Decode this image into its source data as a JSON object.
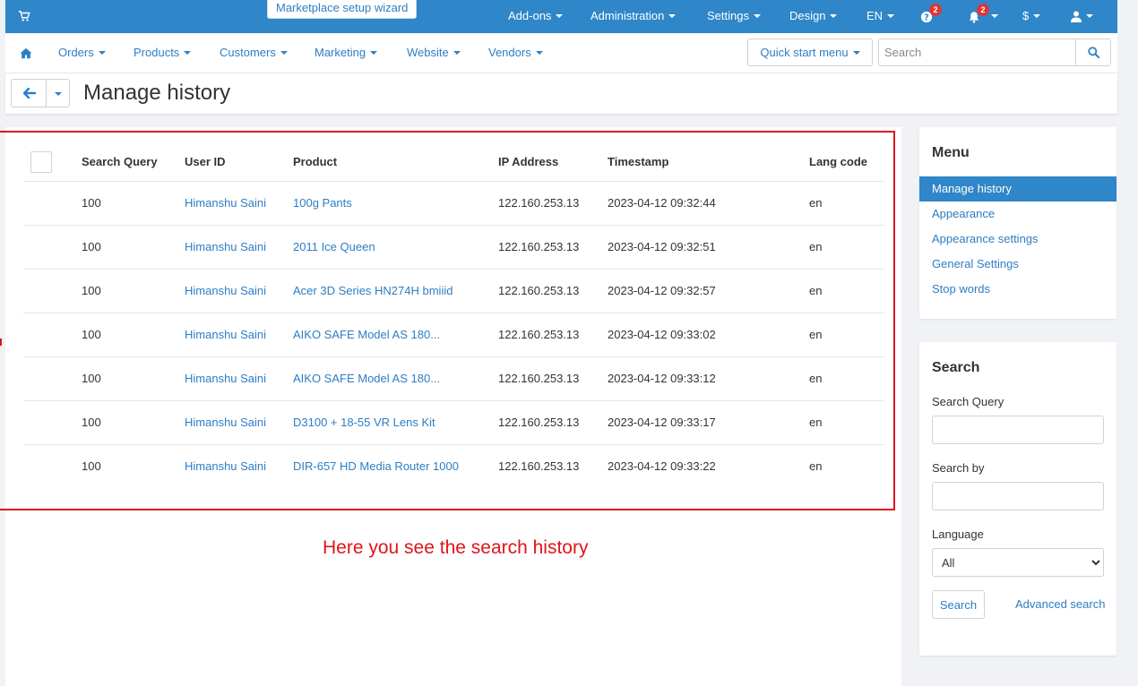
{
  "topbar": {
    "wizard_label": "Marketplace setup wizard",
    "nav": [
      {
        "label": "Add-ons"
      },
      {
        "label": "Administration"
      },
      {
        "label": "Settings"
      },
      {
        "label": "Design"
      },
      {
        "label": "EN"
      },
      {
        "label": "$"
      }
    ],
    "help_badge": "2",
    "notifications_badge": "2"
  },
  "mainnav": {
    "items": [
      "Orders",
      "Products",
      "Customers",
      "Marketing",
      "Website",
      "Vendors"
    ],
    "quick_start": "Quick start menu",
    "search_placeholder": "Search"
  },
  "page": {
    "title": "Manage history"
  },
  "table": {
    "headers": [
      "Search Query",
      "User ID",
      "Product",
      "IP Address",
      "Timestamp",
      "Lang code"
    ],
    "rows": [
      {
        "query": "100",
        "user": "Himanshu Saini",
        "product": "100g Pants",
        "ip": "122.160.253.13",
        "ts": "2023-04-12 09:32:44",
        "lang": "en"
      },
      {
        "query": "100",
        "user": "Himanshu Saini",
        "product": "2011 Ice Queen",
        "ip": "122.160.253.13",
        "ts": "2023-04-12 09:32:51",
        "lang": "en"
      },
      {
        "query": "100",
        "user": "Himanshu Saini",
        "product": "Acer 3D Series HN274H bmiiid",
        "ip": "122.160.253.13",
        "ts": "2023-04-12 09:32:57",
        "lang": "en"
      },
      {
        "query": "100",
        "user": "Himanshu Saini",
        "product": "AIKO SAFE Model AS 180...",
        "ip": "122.160.253.13",
        "ts": "2023-04-12 09:33:02",
        "lang": "en"
      },
      {
        "query": "100",
        "user": "Himanshu Saini",
        "product": "AIKO SAFE Model AS 180...",
        "ip": "122.160.253.13",
        "ts": "2023-04-12 09:33:12",
        "lang": "en"
      },
      {
        "query": "100",
        "user": "Himanshu Saini",
        "product": "D3100 + 18-55 VR Lens Kit",
        "ip": "122.160.253.13",
        "ts": "2023-04-12 09:33:17",
        "lang": "en"
      },
      {
        "query": "100",
        "user": "Himanshu Saini",
        "product": "DIR-657 HD Media Router 1000",
        "ip": "122.160.253.13",
        "ts": "2023-04-12 09:33:22",
        "lang": "en"
      }
    ]
  },
  "annotation": "Here you see the search history",
  "sidebar": {
    "menu_title": "Menu",
    "menu_items": [
      "Manage history",
      "Appearance",
      "Appearance settings",
      "General Settings",
      "Stop words"
    ],
    "search_title": "Search",
    "search_query_label": "Search Query",
    "search_by_label": "Search by",
    "language_label": "Language",
    "language_selected": "All",
    "search_button": "Search",
    "advanced_search": "Advanced search"
  },
  "colors": {
    "primary": "#2f86c8",
    "link": "#2d7ec4",
    "annotation": "#e0141a",
    "badge": "#d9383a"
  },
  "icons": [
    "cart-icon",
    "home-icon",
    "search-icon",
    "arrow-left-icon",
    "help-icon",
    "bell-icon",
    "user-icon"
  ]
}
